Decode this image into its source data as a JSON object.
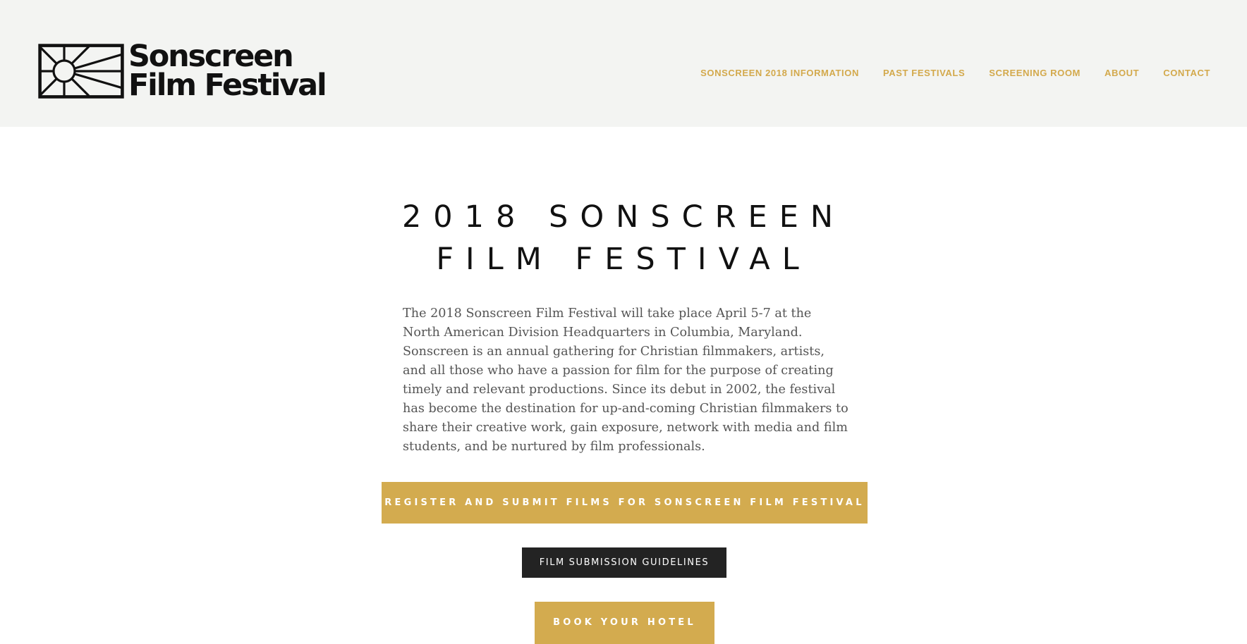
{
  "header": {
    "logo": {
      "line1": "Sonscreen",
      "line2": "Film Festival",
      "icon": "sunburst-frame-icon"
    },
    "nav": [
      {
        "label": "SONSCREEN 2018 INFORMATION"
      },
      {
        "label": "PAST FESTIVALS"
      },
      {
        "label": "SCREENING ROOM"
      },
      {
        "label": "ABOUT"
      },
      {
        "label": "CONTACT"
      }
    ]
  },
  "main": {
    "title_line1": "2018 SONSCREEN",
    "title_line2": "FILM FESTIVAL",
    "intro": "The 2018 Sonscreen Film Festival will take place April 5-7 at the North American Division Headquarters in Columbia, Maryland. Sonscreen is an annual gathering for Christian filmmakers, artists, and all those who have a passion for film for the purpose of creating timely and relevant productions. Since its debut in 2002, the festival has become the destination for up-and-coming Christian filmmakers to share their creative work, gain exposure, network with media and film students, and be nurtured by film professionals.",
    "buttons": {
      "register": "REGISTER AND SUBMIT FILMS FOR SONSCREEN FILM FESTIVAL",
      "guidelines": "FILM SUBMISSION GUIDELINES",
      "hotel": "BOOK YOUR HOTEL"
    }
  },
  "colors": {
    "header_bg": "#f3f4f2",
    "accent_gold": "#d3ab4f",
    "nav_gold": "#d3a94c",
    "dark_button": "#232323",
    "body_text": "#555555"
  }
}
